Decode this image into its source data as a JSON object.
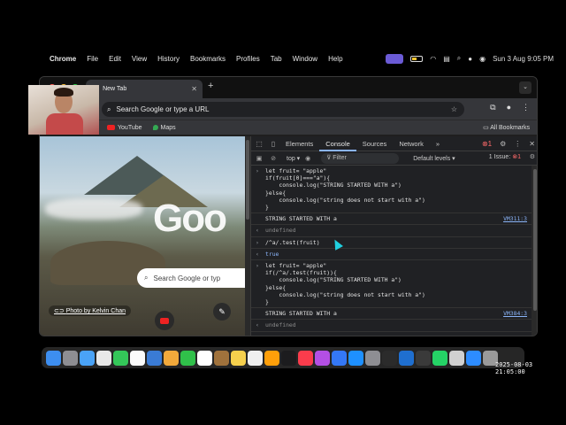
{
  "menubar": {
    "app_name": "Chrome",
    "menus": [
      "File",
      "Edit",
      "View",
      "History",
      "Bookmarks",
      "Profiles",
      "Tab",
      "Window",
      "Help"
    ],
    "datetime": "Sun 3 Aug  9:05 PM"
  },
  "browser": {
    "tab_title": "New Tab",
    "omnibox_placeholder": "Search Google or type a URL",
    "bookmarks": [
      "YouTube",
      "Maps"
    ],
    "all_bookmarks": "All Bookmarks"
  },
  "ntp": {
    "logo_text": "Goo",
    "search_placeholder": "Search Google or typ",
    "photo_credit": "Photo by Kelvin Chan"
  },
  "devtools": {
    "tabs": [
      "Elements",
      "Console",
      "Sources",
      "Network"
    ],
    "active_tab": "Console",
    "more_tabs": "»",
    "error_count": "1",
    "context": "top",
    "filter_placeholder": "Filter",
    "levels": "Default levels",
    "issues": "1 Issue:",
    "issues_count": "1"
  },
  "console": {
    "entry1": {
      "lines": [
        "let fruit= \"apple\"",
        "if(fruit[0]===\"a\"){",
        "    console.log(\"STRING STARTED WITH a\")",
        "}else{",
        "    console.log(\"string does not start with a\")",
        "}"
      ],
      "output": "STRING STARTED WITH a",
      "source": "VM311:3",
      "return": "undefined"
    },
    "entry2": {
      "input": "/^a/.test(fruit)",
      "return": "true"
    },
    "entry3": {
      "lines": [
        "let fruit= \"apple\"",
        "if(/^a/.test(fruit)){",
        "    console.log(\"STRING STARTED WITH a\")",
        "}else{",
        "    console.log(\"string does not start with a\")",
        "}"
      ],
      "output": "STRING STARTED WITH a",
      "source": "VM384:3",
      "return": "undefined"
    }
  },
  "timestamp": "2025-08-03 21:05:00",
  "colors": {
    "traffic_red": "#ff5f57",
    "traffic_yellow": "#febc2e",
    "traffic_green": "#28c840",
    "devtools_bg": "#202124",
    "link_blue": "#8ab4f8"
  },
  "dock_icons": [
    "finder",
    "launchpad",
    "safari",
    "chrome",
    "messages",
    "photos",
    "calendar",
    "notes",
    "music",
    "podcasts",
    "app-store",
    "settings",
    "terminal",
    "vscode",
    "whatsapp",
    "zoom",
    "trash"
  ]
}
